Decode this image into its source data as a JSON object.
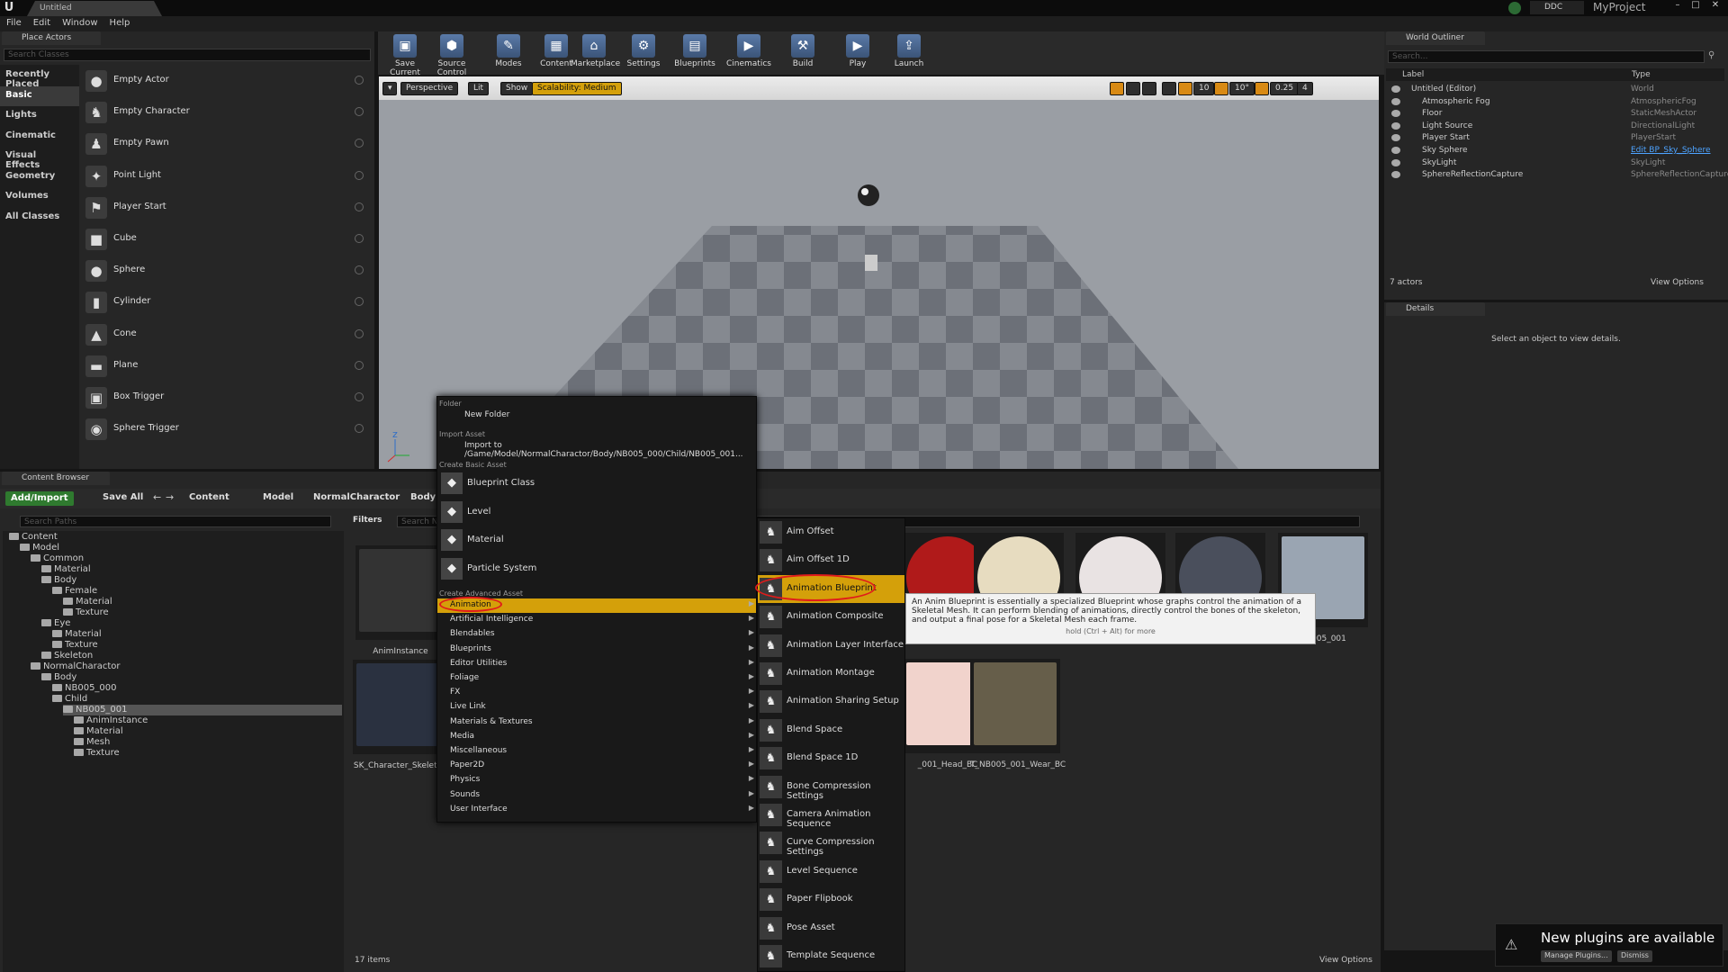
{
  "window": {
    "tab_title": "Untitled",
    "project_name": "MyProject",
    "ddc_label": "DDC"
  },
  "menu": [
    "File",
    "Edit",
    "Window",
    "Help"
  ],
  "place_actors": {
    "title": "Place Actors",
    "search_placeholder": "Search Classes",
    "categories": [
      "Recently Placed",
      "Basic",
      "Lights",
      "Cinematic",
      "Visual Effects",
      "Geometry",
      "Volumes",
      "All Classes"
    ],
    "selected_category": "Basic",
    "items": [
      {
        "label": "Empty Actor",
        "icon": "sphere-icon"
      },
      {
        "label": "Empty Character",
        "icon": "character-icon"
      },
      {
        "label": "Empty Pawn",
        "icon": "pawn-icon"
      },
      {
        "label": "Point Light",
        "icon": "bulb-icon"
      },
      {
        "label": "Player Start",
        "icon": "player-start-icon"
      },
      {
        "label": "Cube",
        "icon": "cube-icon"
      },
      {
        "label": "Sphere",
        "icon": "sphere-icon"
      },
      {
        "label": "Cylinder",
        "icon": "cylinder-icon"
      },
      {
        "label": "Cone",
        "icon": "cone-icon"
      },
      {
        "label": "Plane",
        "icon": "plane-icon"
      },
      {
        "label": "Box Trigger",
        "icon": "box-trigger-icon"
      },
      {
        "label": "Sphere Trigger",
        "icon": "sphere-trigger-icon"
      }
    ]
  },
  "toolbar": [
    {
      "label": "Save Current",
      "icon": "save-icon"
    },
    {
      "label": "Source Control",
      "icon": "source-control-icon"
    },
    {
      "label": "Modes",
      "icon": "modes-icon"
    },
    {
      "label": "Content",
      "icon": "content-icon"
    },
    {
      "label": "Marketplace",
      "icon": "marketplace-icon"
    },
    {
      "label": "Settings",
      "icon": "settings-icon"
    },
    {
      "label": "Blueprints",
      "icon": "blueprints-icon"
    },
    {
      "label": "Cinematics",
      "icon": "cinematics-icon"
    },
    {
      "label": "Build",
      "icon": "build-icon"
    },
    {
      "label": "Play",
      "icon": "play-icon"
    },
    {
      "label": "Launch",
      "icon": "launch-icon"
    }
  ],
  "viewport": {
    "perspective": "Perspective",
    "lit": "Lit",
    "show": "Show",
    "scalability": "Scalability: Medium",
    "grid_snap": "10",
    "rot_snap": "10°",
    "scale_snap": "0.25",
    "cam_speed": "4"
  },
  "outliner": {
    "title": "World Outliner",
    "search_placeholder": "Search...",
    "col_label": "Label",
    "col_type": "Type",
    "rows": [
      {
        "name": "Untitled (Editor)",
        "type": "World",
        "indent": 0
      },
      {
        "name": "Atmospheric Fog",
        "type": "AtmosphericFog",
        "indent": 1
      },
      {
        "name": "Floor",
        "type": "StaticMeshActor",
        "indent": 1
      },
      {
        "name": "Light Source",
        "type": "DirectionalLight",
        "indent": 1
      },
      {
        "name": "Player Start",
        "type": "PlayerStart",
        "indent": 1
      },
      {
        "name": "Sky Sphere",
        "type": "Edit BP_Sky_Sphere",
        "indent": 1,
        "link": true
      },
      {
        "name": "SkyLight",
        "type": "SkyLight",
        "indent": 1
      },
      {
        "name": "SphereReflectionCapture",
        "type": "SphereReflectionCapture",
        "indent": 1
      }
    ],
    "actor_count": "7 actors",
    "view_options": "View Options"
  },
  "details": {
    "title": "Details",
    "empty_text": "Select an object to view details."
  },
  "content_browser": {
    "title": "Content Browser",
    "add_import": "Add/Import",
    "save_all": "Save All",
    "path": [
      "Content",
      "Model",
      "NormalCharactor",
      "Body"
    ],
    "search_paths": "Search Paths",
    "filters": "Filters",
    "search_assets": "Search N",
    "item_count": "17 items",
    "view_options": "View Options",
    "tree": [
      {
        "label": "Content",
        "indent": 0
      },
      {
        "label": "Model",
        "indent": 1
      },
      {
        "label": "Common",
        "indent": 2
      },
      {
        "label": "Material",
        "indent": 3
      },
      {
        "label": "Body",
        "indent": 3
      },
      {
        "label": "Female",
        "indent": 4
      },
      {
        "label": "Material",
        "indent": 5
      },
      {
        "label": "Texture",
        "indent": 5
      },
      {
        "label": "Eye",
        "indent": 3
      },
      {
        "label": "Material",
        "indent": 4
      },
      {
        "label": "Texture",
        "indent": 4
      },
      {
        "label": "Skeleton",
        "indent": 3
      },
      {
        "label": "NormalCharactor",
        "indent": 2
      },
      {
        "label": "Body",
        "indent": 3
      },
      {
        "label": "NB005_000",
        "indent": 4
      },
      {
        "label": "Child",
        "indent": 4
      },
      {
        "label": "NB005_001",
        "indent": 5,
        "selected": true
      },
      {
        "label": "AnimInstance",
        "indent": 6
      },
      {
        "label": "Material",
        "indent": 6
      },
      {
        "label": "Mesh",
        "indent": 6
      },
      {
        "label": "Texture",
        "indent": 6
      }
    ],
    "thumbs": [
      {
        "label": "AnimInstance"
      },
      {
        "label": "SK_Character_Skeleto"
      },
      {
        "label": ""
      },
      {
        "label": ""
      },
      {
        "label": ""
      },
      {
        "label": ""
      },
      {
        "label": "NB005_001"
      },
      {
        "label": "_001_Head_BC"
      },
      {
        "label": "T_NB005_001_Wear_BC"
      }
    ]
  },
  "context_menu": {
    "folder_header": "Folder",
    "new_folder": "New Folder",
    "import_header": "Import Asset",
    "import_to": "Import to /Game/Model/NormalCharactor/Body/NB005_000/Child/NB005_001...",
    "basic_header": "Create Basic Asset",
    "basic": [
      {
        "label": "Blueprint Class",
        "icon": "blueprint-class-icon"
      },
      {
        "label": "Level",
        "icon": "level-icon"
      },
      {
        "label": "Material",
        "icon": "material-icon"
      },
      {
        "label": "Particle System",
        "icon": "particle-system-icon"
      }
    ],
    "advanced_header": "Create Advanced Asset",
    "advanced": [
      "Animation",
      "Artificial Intelligence",
      "Blendables",
      "Blueprints",
      "Editor Utilities",
      "Foliage",
      "FX",
      "Live Link",
      "Materials & Textures",
      "Media",
      "Miscellaneous",
      "Paper2D",
      "Physics",
      "Sounds",
      "User Interface"
    ],
    "selected_advanced": "Animation"
  },
  "animation_submenu": [
    {
      "label": "Aim Offset"
    },
    {
      "label": "Aim Offset 1D"
    },
    {
      "label": "Animation Blueprint",
      "selected": true
    },
    {
      "label": "Animation Composite"
    },
    {
      "label": "Animation Layer Interface"
    },
    {
      "label": "Animation Montage"
    },
    {
      "label": "Animation Sharing Setup"
    },
    {
      "label": "Blend Space"
    },
    {
      "label": "Blend Space 1D"
    },
    {
      "label": "Bone Compression Settings"
    },
    {
      "label": "Camera Animation Sequence"
    },
    {
      "label": "Curve Compression Settings"
    },
    {
      "label": "Level Sequence"
    },
    {
      "label": "Paper Flipbook"
    },
    {
      "label": "Pose Asset"
    },
    {
      "label": "Template Sequence"
    }
  ],
  "tooltip": {
    "text": "An Anim Blueprint is essentially a specialized Blueprint whose graphs control the animation of a Skeletal Mesh. It can perform blending of animations, directly control the bones of the skeleton, and output a final pose for a Skeletal Mesh each frame.",
    "hint": "hold (Ctrl + Alt) for more"
  },
  "notification": {
    "title": "New plugins are available",
    "manage": "Manage Plugins...",
    "dismiss": "Dismiss"
  }
}
